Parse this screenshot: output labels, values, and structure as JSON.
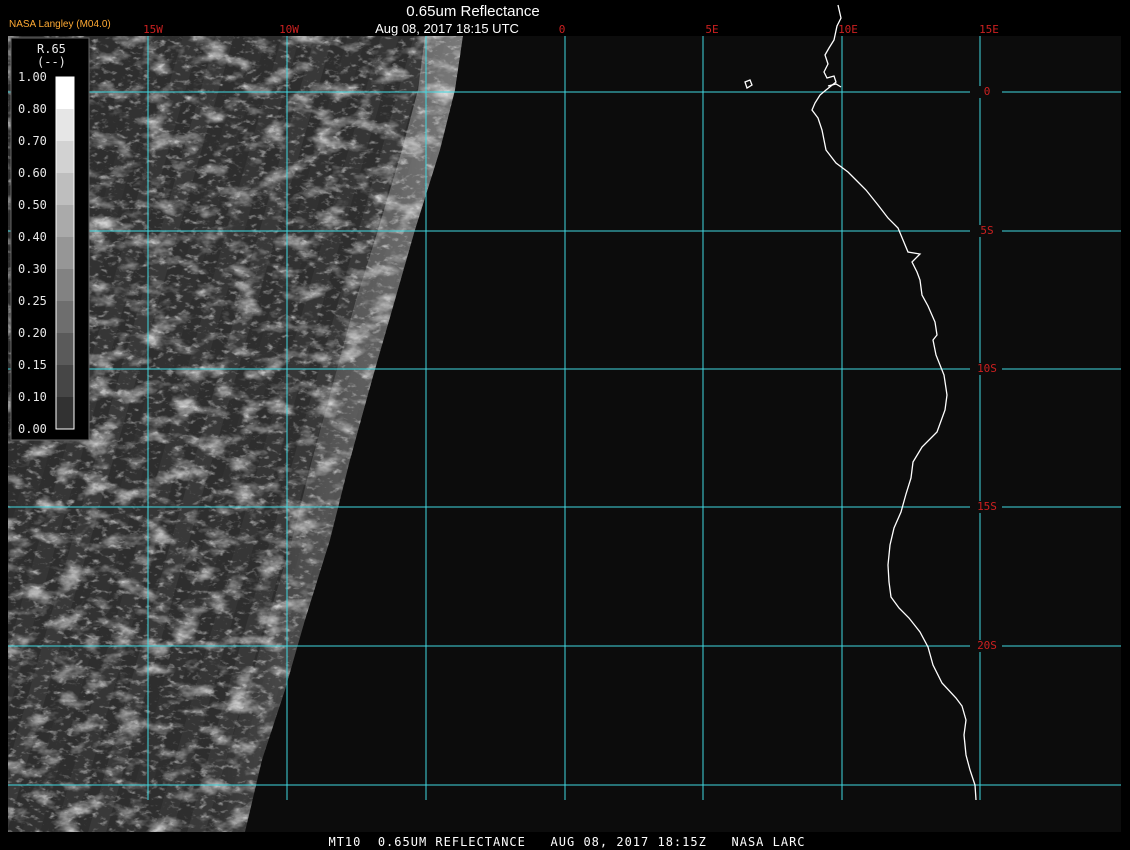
{
  "header": {
    "title": "0.65um Reflectance",
    "subtitle": "Aug 08, 2017 18:15 UTC",
    "credit": "NASA Langley (M04.0)"
  },
  "map": {
    "lon_labels": [
      "15W",
      "10W",
      "0",
      "5E",
      "10E",
      "15E"
    ],
    "lat_labels": [
      "0",
      "5S",
      "10S",
      "15S",
      "20S"
    ],
    "grid_color": "#40d8e0",
    "label_color": "#cc2020",
    "coast_color": "#ffffff"
  },
  "colorbar": {
    "name": "R.65",
    "unit": "(--)",
    "ticks": [
      "1.00",
      "0.80",
      "0.70",
      "0.60",
      "0.50",
      "0.40",
      "0.30",
      "0.25",
      "0.20",
      "0.15",
      "0.10",
      "0.00"
    ]
  },
  "footer": {
    "text": "MT10  0.65UM REFLECTANCE   AUG 08, 2017 18:15Z   NASA LARC"
  }
}
